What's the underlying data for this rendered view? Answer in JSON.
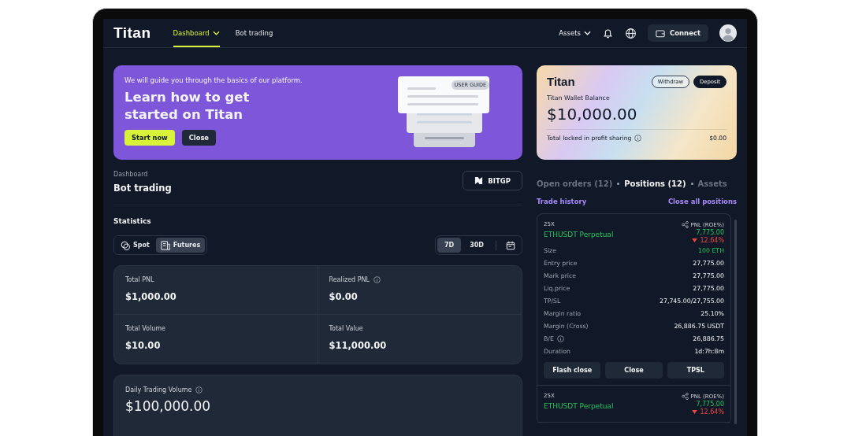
{
  "nav": {
    "logo": "Titan",
    "items": [
      {
        "label": "Dashboard",
        "selected": true,
        "dropdown": true
      },
      {
        "label": "Bot trading",
        "selected": false,
        "dropdown": false
      }
    ],
    "assets_menu": "Assets",
    "connect": "Connect"
  },
  "banner": {
    "subtitle": "We will guide you through the basics of our platform.",
    "title": "Learn how to get started on Titan",
    "buttons": [
      {
        "label": "Start now",
        "kind": "primary"
      },
      {
        "label": "Close",
        "kind": "secondary"
      }
    ],
    "badge": "USER GUIDE"
  },
  "page": {
    "breadcrumb": "Dashboard",
    "title": "Bot trading",
    "exchange": "BITGP"
  },
  "statistics": {
    "heading": "Statistics",
    "market_tabs": [
      {
        "label": "Spot",
        "selected": false
      },
      {
        "label": "Futures",
        "selected": true
      }
    ],
    "period_tabs": [
      {
        "label": "7D",
        "selected": true
      },
      {
        "label": "30D",
        "selected": false
      }
    ],
    "stats": [
      {
        "label": "Total PNL",
        "value": "$1,000.00",
        "info": false
      },
      {
        "label": "Realized PNL",
        "value": "$0.00",
        "info": true
      },
      {
        "label": "Total Volume",
        "value": "$10.00",
        "info": false
      },
      {
        "label": "Total Value",
        "value": "$11,000.00",
        "info": false
      }
    ],
    "daily": {
      "label": "Daily Trading Volume",
      "value": "$100,000.00"
    }
  },
  "wallet": {
    "logo": "Titan",
    "buttons": [
      {
        "label": "Withdraw",
        "kind": "outline"
      },
      {
        "label": "Deposit",
        "kind": "solid"
      }
    ],
    "label": "Titan Wallet Balance",
    "balance": "$10,000.00",
    "locked_label": "Total locked in profit sharing",
    "locked_value": "$0.00"
  },
  "panel_tabs": [
    {
      "label": "Open orders (12)",
      "selected": false
    },
    {
      "label": "Positions (12)",
      "selected": true
    },
    {
      "label": "Assets",
      "selected": false
    }
  ],
  "links": {
    "trade_history": "Trade history",
    "close_all": "Close all positions"
  },
  "positions": [
    {
      "leverage": "25X",
      "symbol": "ETHUSDT Perpetual",
      "pnl_label": "PNL (ROE%)",
      "pnl": "7,775.00",
      "roe": "12.64%",
      "kind": "down",
      "rows": [
        {
          "label": "Size",
          "value": "100 ETH",
          "kind": "accent",
          "info": false
        },
        {
          "label": "Entry price",
          "value": "27,775.00",
          "kind": "plain",
          "info": false
        },
        {
          "label": "Mark price",
          "value": "27,775.00",
          "kind": "plain",
          "info": false
        },
        {
          "label": "Liq.price",
          "value": "27,775.00",
          "kind": "plain",
          "info": false
        },
        {
          "label": "TP/SL",
          "value": "27,745.00/27,755.00",
          "kind": "plain",
          "info": false
        },
        {
          "label": "Margin ratio",
          "value": "25.10%",
          "kind": "plain",
          "info": false
        },
        {
          "label": "Margin (Cross)",
          "value": "26,886.75 USDT",
          "kind": "plain",
          "info": false
        },
        {
          "label": "B/E",
          "value": "26,886.75",
          "kind": "plain",
          "info": true
        },
        {
          "label": "Duration",
          "value": "1d:7h:8m",
          "kind": "plain",
          "info": false
        }
      ],
      "actions": [
        "Flash close",
        "Close",
        "TPSL"
      ]
    },
    {
      "leverage": "25X",
      "symbol": "ETHUSDT Perpetual",
      "pnl_label": "PNL (ROE%)",
      "pnl": "7,775.00",
      "roe": "12.64%",
      "kind": "down"
    }
  ]
}
